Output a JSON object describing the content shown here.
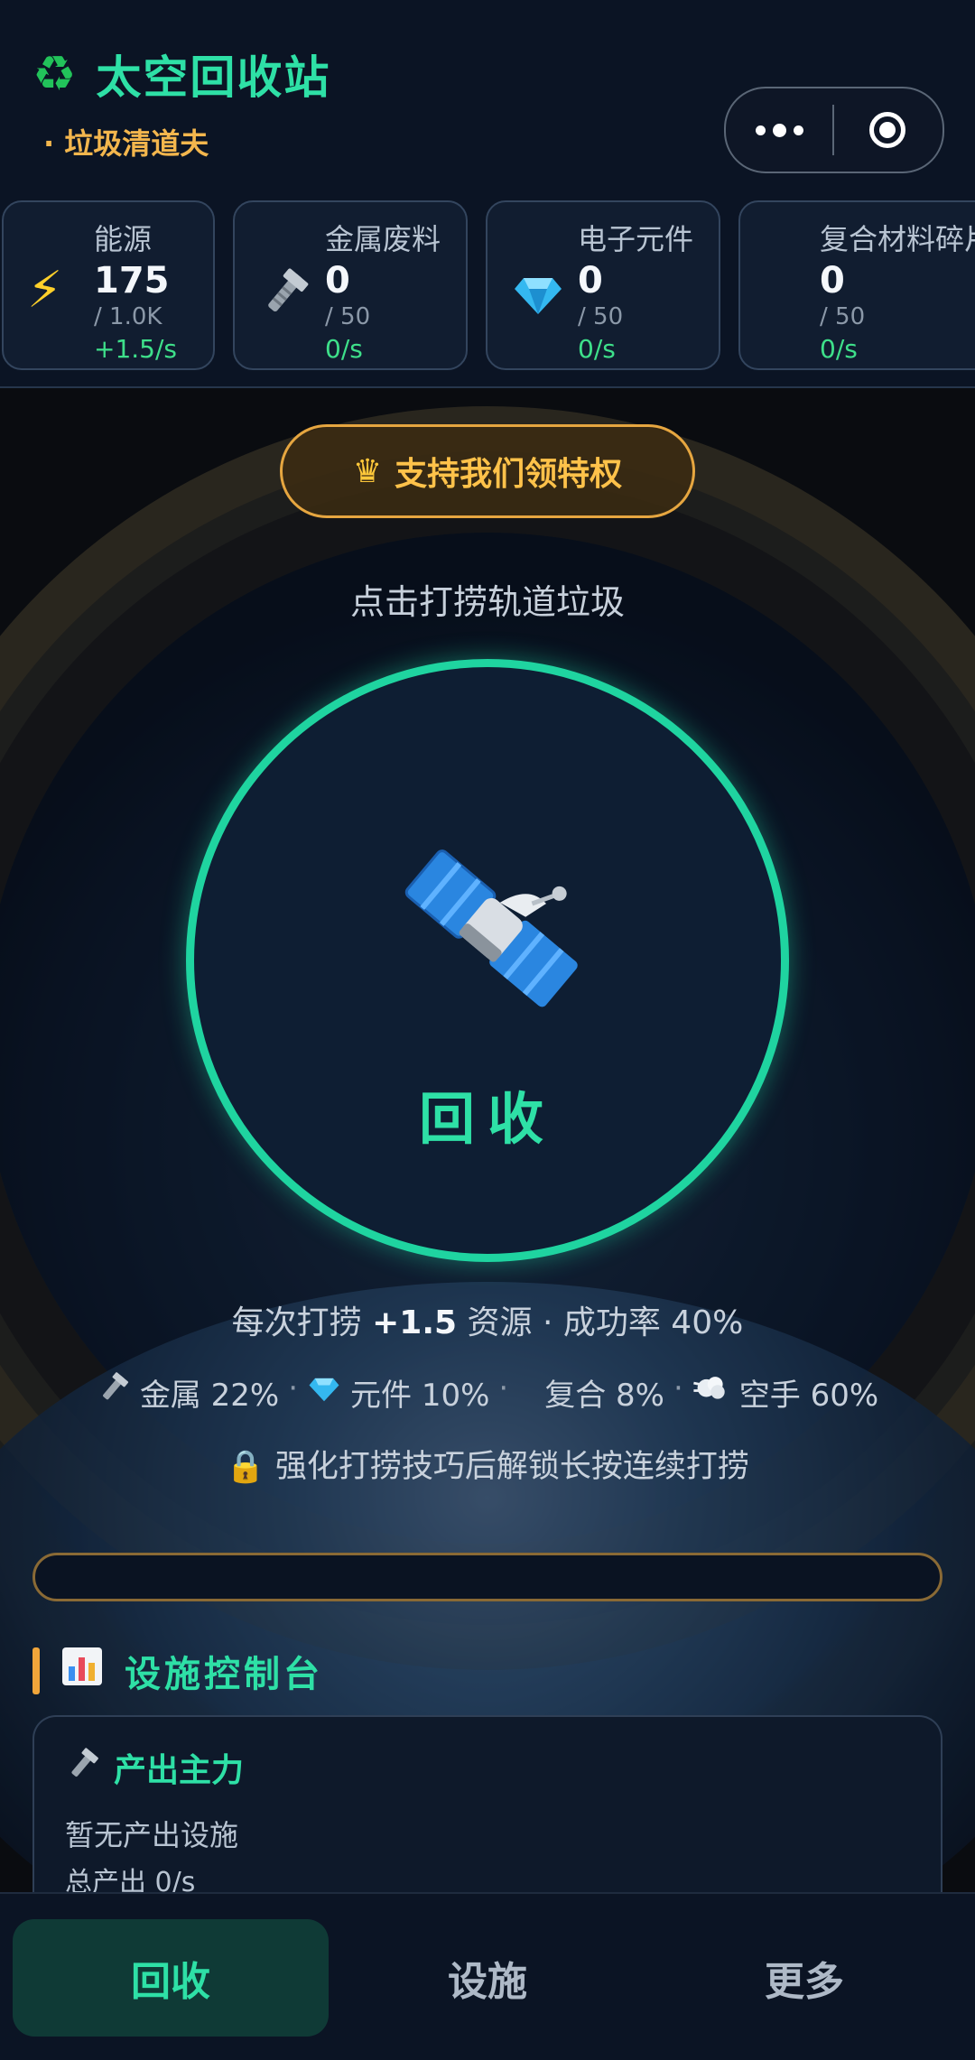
{
  "header": {
    "title": "太空回收站",
    "subtitle": "· 垃圾清道夫",
    "icon": "recycle-icon"
  },
  "resources": [
    {
      "name": "能源",
      "value": "175",
      "cap": "/ 1.0K",
      "rate": "+1.5/s",
      "icon": "lightning-icon"
    },
    {
      "name": "金属废料",
      "value": "0",
      "cap": "/ 50",
      "rate": "0/s",
      "icon": "bolt-icon"
    },
    {
      "name": "电子元件",
      "value": "0",
      "cap": "/ 50",
      "rate": "0/s",
      "icon": "gem-icon"
    },
    {
      "name": "复合材料碎片",
      "value": "0",
      "cap": "/ 50",
      "rate": "0/s",
      "icon": "composite-icon"
    }
  ],
  "privilege": {
    "label": "支持我们领特权"
  },
  "main": {
    "hint": "点击打捞轨道垃圾",
    "collect_label": "回收",
    "yield_prefix": "每次打捞",
    "yield_amount": "+1.5",
    "yield_suffix": "资源 · 成功率 40%",
    "drops": [
      {
        "icon": "bolt-icon",
        "text": "金属 22%"
      },
      {
        "icon": "gem-icon",
        "text": "元件 10%"
      },
      {
        "icon": "composite-icon",
        "text": "复合 8%"
      },
      {
        "icon": "puff-icon",
        "text": "空手 60%"
      }
    ],
    "lock_text": "强化打捞技巧后解锁长按连续打捞",
    "progress": 0
  },
  "facilities": {
    "section_title": "设施控制台",
    "card_title": "产出主力",
    "empty_text": "暂无产出设施",
    "total_text": "总产出 0/s"
  },
  "tabs": [
    {
      "label": "回收",
      "active": true
    },
    {
      "label": "设施",
      "active": false
    },
    {
      "label": "更多",
      "active": false
    }
  ],
  "colors": {
    "accent": "#2ee0a6",
    "gold": "#f3b64d",
    "rate_green": "#3ee08a"
  }
}
